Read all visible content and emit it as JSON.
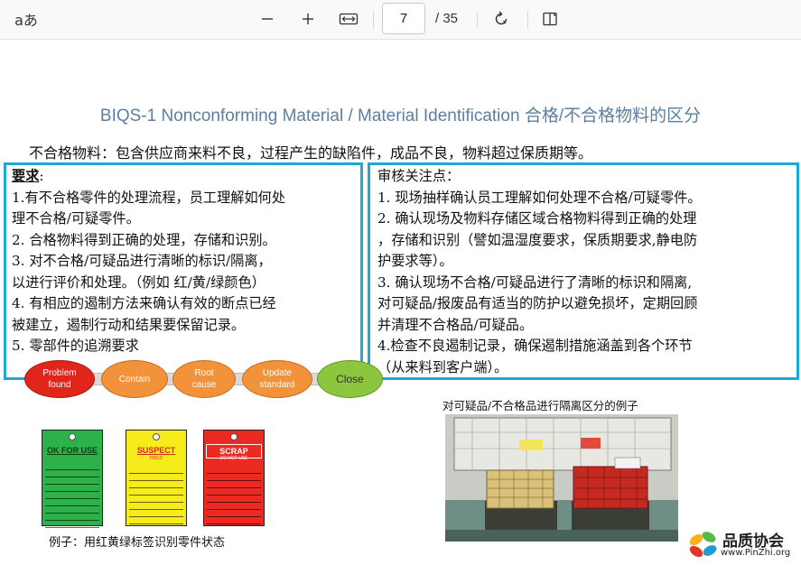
{
  "toolbar": {
    "read_aloud_glyph": "aあ",
    "page_number": "7",
    "page_count": "/ 35"
  },
  "slide": {
    "title": "BIQS-1 Nonconforming Material / Material Identification 合格/不合格物料的区分",
    "intro": "不合格物料：包含供应商来料不良，过程产生的缺陷件，成品不良，物料超过保质期等。",
    "requirements": {
      "heading": "要求",
      "heading_colon": ":",
      "lines": [
        "1.有不合格零件的处理流程，员工理解如何处",
        "理不合格/可疑零件。",
        "2. 合格物料得到正确的处理，存储和识别。",
        "3. 对不合格/可疑品进行清晰的标识/隔离，",
        "以进行评价和处理。（例如 红/黄/绿颜色）",
        "4. 有相应的遏制方法来确认有效的断点已经",
        "被建立，遏制行动和结果要保留记录。",
        "5. 零部件的追溯要求"
      ]
    },
    "audit": {
      "heading": "审核关注点：",
      "lines": [
        "1. 现场抽样确认员工理解如何处理不合格/可疑零件。",
        "2. 确认现场及物料存储区域合格物料得到正确的处理",
        "，存储和识别（譬如温湿度要求，保质期要求,静电防",
        "护要求等）。",
        "3. 确认现场不合格/可疑品进行了清晰的标识和隔离,",
        "对可疑品/报废品有适当的防护以避免损坏，定期回顾",
        "并清理不合格品/可疑品。",
        "4.检查不良遏制记录，确保遏制措施涵盖到各个环节",
        "（从来料到客户端）。"
      ]
    },
    "flow": [
      {
        "label": "Problem\nfound",
        "color": "#e0261b"
      },
      {
        "label": "Contain",
        "color": "#f2923a"
      },
      {
        "label": "Root\ncause",
        "color": "#f2923a"
      },
      {
        "label": "Update\nstandard",
        "color": "#f2923a"
      },
      {
        "label": "Close",
        "color": "#8cc63f"
      }
    ],
    "tags": [
      {
        "title": "OK FOR USE",
        "sub": "",
        "color": "#2db24a",
        "title_color": "#0b7a23"
      },
      {
        "title": "SUSPECT",
        "sub": "HOLD",
        "color": "#f7ec1b",
        "title_color": "#d9261c"
      },
      {
        "title": "SCRAP",
        "sub": "DO NOT USE",
        "color": "#ec2a22",
        "title_color": "#ec2a22"
      }
    ],
    "tags_caption": "例子：用红黄绿标签识别零件状态",
    "photo_caption": "对可疑品/不合格品进行隔离区分的例子",
    "logo": {
      "name": "品质协会",
      "url": "www.PinZhi.org"
    }
  }
}
